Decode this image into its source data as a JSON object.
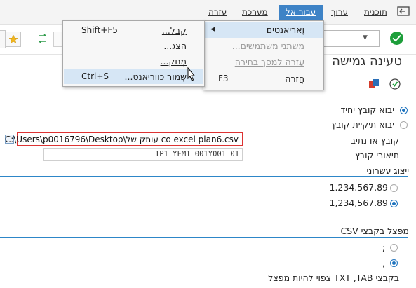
{
  "menubar": {
    "items": [
      "תוכנית",
      "ערוך",
      "עבור אל",
      "מערכת",
      "עזרה"
    ]
  },
  "title": "טעינה גמישה",
  "goto_menu": {
    "items": [
      {
        "label": "וָאריאנטים",
        "shortcut": ""
      },
      {
        "label": "מִשתני משתמשים...",
        "shortcut": ""
      },
      {
        "label": "עֶזרה למסך בחירה",
        "shortcut": ""
      },
      {
        "label": "חֲזרה",
        "shortcut": "F3"
      }
    ]
  },
  "variants_submenu": {
    "items": [
      {
        "label": "קַבל...",
        "shortcut": "Shift+F5"
      },
      {
        "label": "הַצג...",
        "shortcut": ""
      },
      {
        "label": "מְחק...",
        "shortcut": ""
      },
      {
        "label": "שְמור כווריאנט...",
        "shortcut": "Ctrl+S"
      }
    ]
  },
  "form": {
    "radio_single_file": "יבוא קובץ יחיד",
    "radio_folder": "יבוא תיקיית קובץ",
    "path_label": "קובץ או נתיב",
    "path_value": "C:\\Users\\p0016796\\Desktop\\עותק של co excel plan6.csv",
    "desc_label": "תיאורי קובץ",
    "desc_value": "1P1_YFM1_001Y001_01"
  },
  "decimal_section": {
    "title": "ייצוג עשרוני",
    "option1": "1.234.567,89",
    "option2": "1,234,567.89"
  },
  "csv_section": {
    "title": "מפצל בקבצי CSV",
    "option1": ";",
    "option2": ",",
    "note": "בקבצי TXT ,TAB צפוי להיות מפצל"
  },
  "colors": {
    "accent": "#3e83c6",
    "ok_green": "#1d9e3a",
    "section_line": "#2d86c8"
  }
}
